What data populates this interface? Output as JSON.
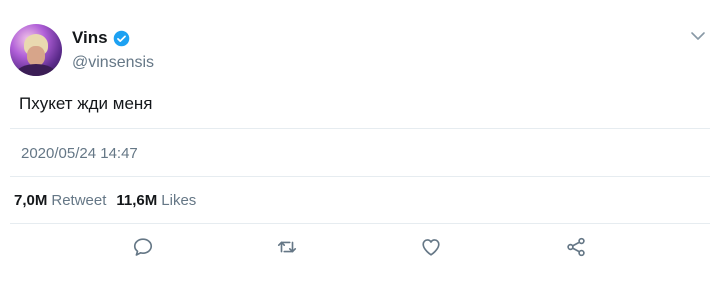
{
  "user": {
    "display_name": "Vins",
    "handle": "@vinsensis",
    "verified": true
  },
  "tweet": {
    "text": "Пхукет жди меня",
    "timestamp": "2020/05/24 14:47"
  },
  "stats": {
    "retweets_count": "7,0M",
    "retweets_label": "Retweet",
    "likes_count": "11,6M",
    "likes_label": "Likes"
  },
  "actions": [
    "reply-icon",
    "retweet-icon",
    "like-icon",
    "share-icon"
  ],
  "colors": {
    "verified": "#1da1f2",
    "secondary_text": "#657786",
    "icon": "#657786",
    "divider": "#e6ecf0"
  }
}
